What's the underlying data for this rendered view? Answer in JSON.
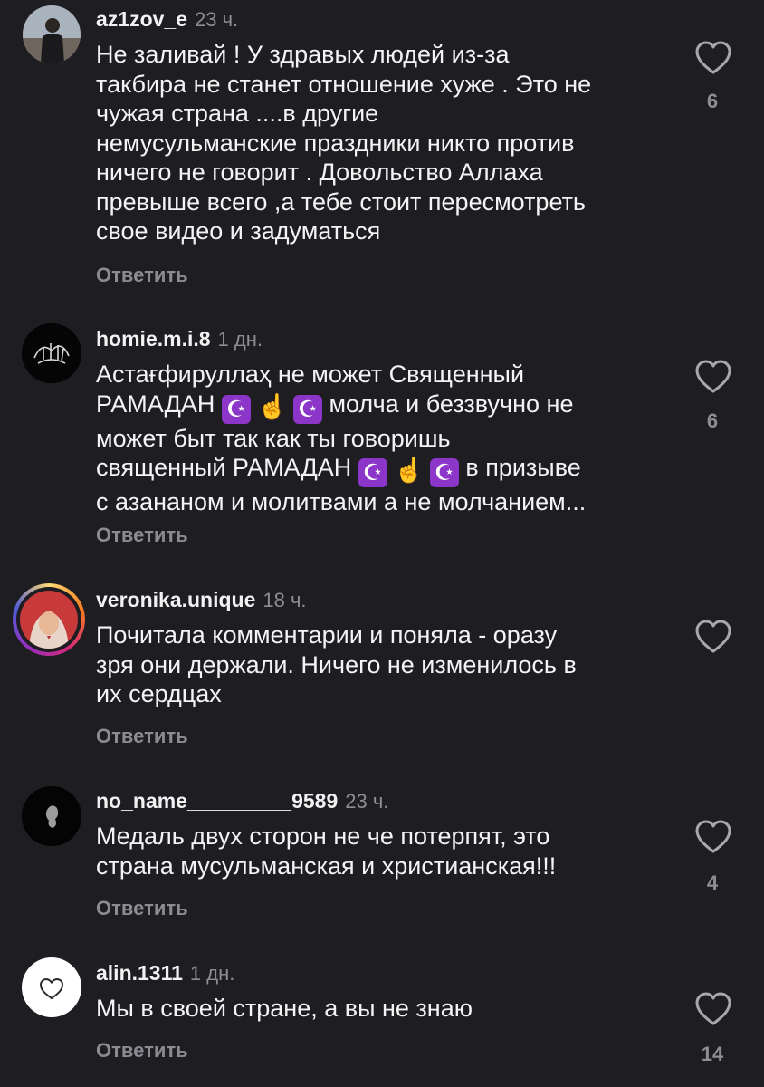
{
  "comments": [
    {
      "username": "az1zov_e",
      "time": "23 ч.",
      "lines": [
        "Не заливай ! У здравых людей из-за",
        "такбира не станет отношение хуже . Это не",
        "чужая страна ....в другие",
        "немусульманские праздники никто против",
        "ничего не говорит . Довольство Аллаха",
        "превыше всего ,а тебе стоит пересмотреть",
        "свое видео и задуматься"
      ],
      "reply": "Ответить",
      "likes": "6"
    },
    {
      "username": "homie.m.i.8",
      "time": "1 дн.",
      "lines": [
        "Астағфируллаҳ не может Священный",
        [
          "РАМАДАН ",
          "☪",
          "☝",
          "☪",
          " молча и беззвучно не"
        ],
        "может быт так как ты говоришь",
        [
          "священный РАМАДАН ",
          "☪",
          "☝",
          "☪",
          " в призыве"
        ],
        "с азананом и молитвами а не молчанием..."
      ],
      "reply": "Ответить",
      "likes": "6"
    },
    {
      "username": "veronika.unique",
      "time": "18 ч.",
      "lines": [
        "Почитала комментарии и поняла - оразу",
        "зря они держали. Ничего не изменилось в",
        "их сердцах"
      ],
      "reply": "Ответить",
      "likes": ""
    },
    {
      "username": "no_name_________9589",
      "time": "23 ч.",
      "lines": [
        "Медаль двух сторон не че потерпят, это",
        "страна мусульманская и христианская!!!"
      ],
      "reply": "Ответить",
      "likes": "4"
    },
    {
      "username": "alin.1311",
      "time": "1 дн.",
      "lines": [
        "Мы в своей стране, а вы не знаю"
      ],
      "reply": "Ответить",
      "likes": "14"
    }
  ],
  "icons": {
    "like": "heart-outline-icon",
    "emoji_moon": "star-and-crescent-icon",
    "emoji_hand": "index-pointing-up-icon"
  },
  "colors": {
    "background": "#1e1d22",
    "muted": "#8e8d93",
    "emoji_purple": "#8b35c9",
    "story_ring": "#d62976"
  }
}
